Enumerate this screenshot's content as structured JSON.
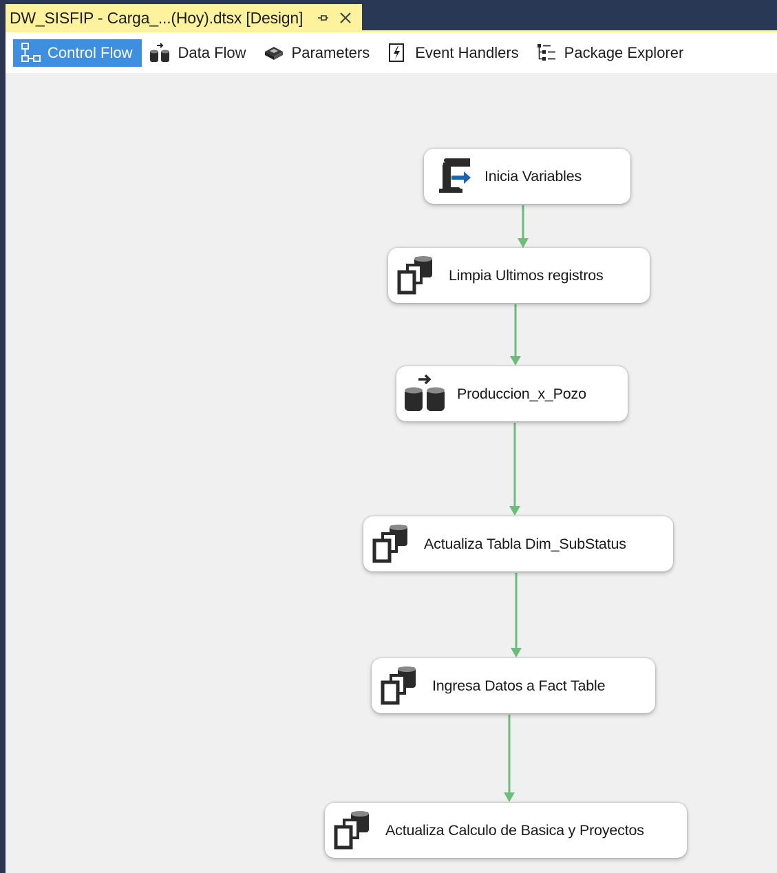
{
  "document_tab": {
    "title": "DW_SISFIP - Carga_...(Hoy).dtsx [Design]",
    "pin_icon": "pin-icon",
    "close_icon": "close-icon"
  },
  "designer_tabs": [
    {
      "label": "Control Flow",
      "icon": "control-flow-icon",
      "active": true
    },
    {
      "label": "Data Flow",
      "icon": "data-flow-icon",
      "active": false
    },
    {
      "label": "Parameters",
      "icon": "parameters-icon",
      "active": false
    },
    {
      "label": "Event Handlers",
      "icon": "event-handlers-icon",
      "active": false
    },
    {
      "label": "Package Explorer",
      "icon": "package-explorer-icon",
      "active": false
    }
  ],
  "tasks": [
    {
      "label": "Inicia Variables",
      "icon": "script-task-icon"
    },
    {
      "label": "Limpia Ultimos registros",
      "icon": "execute-sql-task-icon"
    },
    {
      "label": "Produccion_x_Pozo",
      "icon": "data-flow-task-icon"
    },
    {
      "label": "Actualiza Tabla Dim_SubStatus",
      "icon": "execute-sql-task-icon"
    },
    {
      "label": "Ingresa Datos a Fact Table",
      "icon": "execute-sql-task-icon"
    },
    {
      "label": "Actualiza Calculo de Basica y Proyectos",
      "icon": "execute-sql-task-icon"
    }
  ],
  "colors": {
    "active_tab": "#3e8fe0",
    "document_tab": "#fff29d",
    "frame": "#293955",
    "connector": "#6cbd7c",
    "icon_dark": "#2a2a2a",
    "script_arrow": "#1f63b5"
  }
}
